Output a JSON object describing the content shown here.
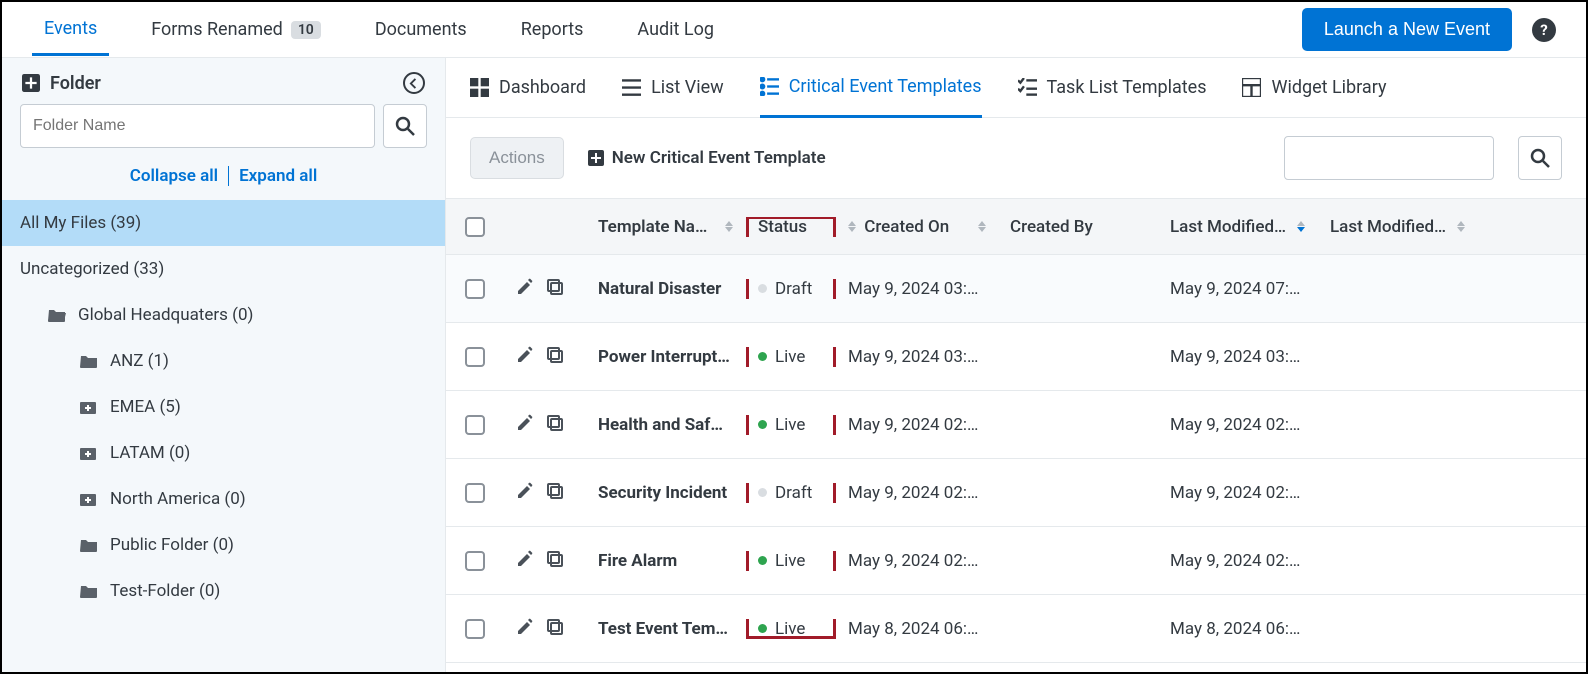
{
  "topnav": {
    "tabs": [
      {
        "label": "Events",
        "active": true
      },
      {
        "label": "Forms Renamed",
        "badge": "10"
      },
      {
        "label": "Documents"
      },
      {
        "label": "Reports"
      },
      {
        "label": "Audit Log"
      }
    ],
    "launch_label": "Launch a New Event"
  },
  "sidebar": {
    "folder_header": "Folder",
    "folder_placeholder": "Folder Name",
    "collapse_all": "Collapse all",
    "expand_all": "Expand all",
    "items": [
      {
        "label": "All My Files (39)",
        "level": 1,
        "selected": true,
        "icon": "none"
      },
      {
        "label": "Uncategorized (33)",
        "level": 1,
        "icon": "none"
      },
      {
        "label": "Global Headquaters (0)",
        "level": 2,
        "icon": "folder-open"
      },
      {
        "label": "ANZ (1)",
        "level": 3,
        "icon": "folder"
      },
      {
        "label": "EMEA (5)",
        "level": 3,
        "icon": "folder-plus"
      },
      {
        "label": "LATAM (0)",
        "level": 3,
        "icon": "folder-plus"
      },
      {
        "label": "North America (0)",
        "level": 3,
        "icon": "folder-plus"
      },
      {
        "label": "Public Folder (0)",
        "level": 3,
        "icon": "folder"
      },
      {
        "label": "Test-Folder (0)",
        "level": 3,
        "icon": "folder"
      }
    ]
  },
  "subnav": {
    "tabs": [
      {
        "label": "Dashboard",
        "icon": "grid"
      },
      {
        "label": "List View",
        "icon": "list"
      },
      {
        "label": "Critical Event Templates",
        "icon": "list-check",
        "active": true
      },
      {
        "label": "Task List Templates",
        "icon": "tasks"
      },
      {
        "label": "Widget Library",
        "icon": "table"
      }
    ]
  },
  "toolbar": {
    "actions_label": "Actions",
    "new_template_label": "New Critical Event Template"
  },
  "table": {
    "headers": {
      "name": "Template Na…",
      "status": "Status",
      "created_on": "Created On",
      "created_by": "Created By",
      "modified_on": "Last Modified…",
      "modified_by": "Last Modified…"
    },
    "rows": [
      {
        "name": "Natural Disaster",
        "status": "Draft",
        "status_kind": "draft",
        "created_on": "May 9, 2024 03:…",
        "created_by": "",
        "modified_on": "May 9, 2024 07:…",
        "modified_by": ""
      },
      {
        "name": "Power Interrupt…",
        "status": "Live",
        "status_kind": "live",
        "created_on": "May 9, 2024 03:…",
        "created_by": "",
        "modified_on": "May 9, 2024 03:…",
        "modified_by": ""
      },
      {
        "name": "Health and Saf…",
        "status": "Live",
        "status_kind": "live",
        "created_on": "May 9, 2024 02:…",
        "created_by": "",
        "modified_on": "May 9, 2024 02:…",
        "modified_by": ""
      },
      {
        "name": "Security Incident",
        "status": "Draft",
        "status_kind": "draft",
        "created_on": "May 9, 2024 02:…",
        "created_by": "",
        "modified_on": "May 9, 2024 02:…",
        "modified_by": ""
      },
      {
        "name": "Fire Alarm",
        "status": "Live",
        "status_kind": "live",
        "created_on": "May 9, 2024 02:…",
        "created_by": "",
        "modified_on": "May 9, 2024 02:…",
        "modified_by": ""
      },
      {
        "name": "Test Event Tem…",
        "status": "Live",
        "status_kind": "live",
        "created_on": "May 8, 2024 06:…",
        "created_by": "",
        "modified_on": "May 8, 2024 06:…",
        "modified_by": ""
      }
    ]
  }
}
